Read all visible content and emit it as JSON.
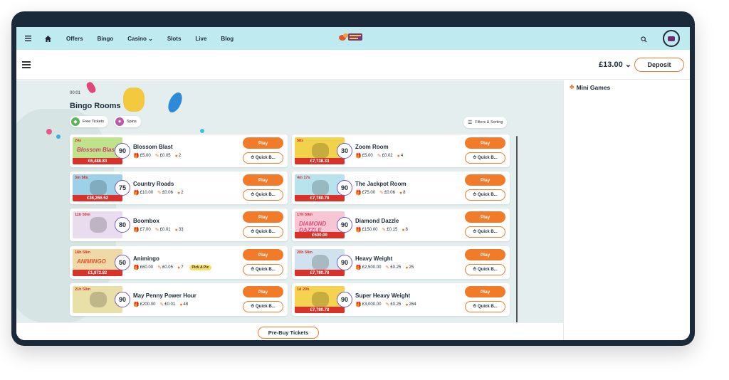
{
  "nav": {
    "links": [
      "Offers",
      "Bingo",
      "Casino",
      "Slots",
      "Live",
      "Blog"
    ],
    "casino_chevron": "⌄",
    "logo_alt": "bingo-logo"
  },
  "account": {
    "balance": "£13.00",
    "chevron": "⌄",
    "deposit_label": "Deposit"
  },
  "bingo": {
    "timer": "00:01",
    "heading": "Bingo Rooms",
    "chips": [
      "Free Tickets",
      "Spins"
    ],
    "filters_label": "Filters & Sorting",
    "rooms": [
      {
        "time": "24s",
        "name": "Blossom Blast",
        "ball": "90",
        "jackpot": "£6,488.83",
        "ticket": "£5.00",
        "price": "£0.05",
        "players": "2",
        "art": "Blossom Blast",
        "art_color": "#d13a6a",
        "bg": "#bfe38a",
        "pick": ""
      },
      {
        "time": "58s",
        "name": "Zoom Room",
        "ball": "30",
        "jackpot": "£7,738.33",
        "ticket": "£5.00",
        "price": "£0.02",
        "players": "4",
        "art": "",
        "art_color": "#222",
        "bg": "#f1d24b",
        "pick": ""
      },
      {
        "time": "3m 58s",
        "name": "Country Roads",
        "ball": "75",
        "jackpot": "£36,266.52",
        "ticket": "£10.00",
        "price": "£0.06",
        "players": "2",
        "art": "",
        "art_color": "#222",
        "bg": "#9ed1e8",
        "pick": ""
      },
      {
        "time": "4m 17s",
        "name": "The Jackpot Room",
        "ball": "90",
        "jackpot": "£7,780.78",
        "ticket": "£75.00",
        "price": "£0.06",
        "players": "8",
        "art": "",
        "art_color": "#222",
        "bg": "#b9e3ec",
        "pick": ""
      },
      {
        "time": "11h 59m",
        "name": "Boombox",
        "ball": "80",
        "jackpot": "",
        "ticket": "£7.00",
        "price": "£0.01",
        "players": "33",
        "art": "",
        "art_color": "#222",
        "bg": "#e9dcef",
        "pick": ""
      },
      {
        "time": "17h 59m",
        "name": "Diamond Dazzle",
        "ball": "90",
        "jackpot": "£500.00",
        "ticket": "£150.00",
        "price": "£0.15",
        "players": "8",
        "art": "DIAMOND DAZZLE",
        "art_color": "#e04b78",
        "bg": "#f7c6d4",
        "pick": ""
      },
      {
        "time": "18h 58m",
        "name": "Animingo",
        "ball": "50",
        "jackpot": "£1,872.82",
        "ticket": "£60.00",
        "price": "£0.05",
        "players": "7",
        "art": "ANIMINGO",
        "art_color": "#e3562f",
        "bg": "#efd9a6",
        "pick": "Pick A Pic"
      },
      {
        "time": "20h 58m",
        "name": "Heavy Weight",
        "ball": "90",
        "jackpot": "£7,780.78",
        "ticket": "£2,500.00",
        "price": "£0.25",
        "players": "25",
        "art": "",
        "art_color": "#222",
        "bg": "#cfe2ee",
        "pick": ""
      },
      {
        "time": "21h 59m",
        "name": "May Penny Power Hour",
        "ball": "90",
        "jackpot": "",
        "ticket": "£200.00",
        "price": "£0.01",
        "players": "48",
        "art": "",
        "art_color": "#222",
        "bg": "#e9e0a8",
        "pick": ""
      },
      {
        "time": "1d 20h",
        "name": "Super Heavy Weight",
        "ball": "90",
        "jackpot": "£7,780.78",
        "ticket": "£3,000.00",
        "price": "£0.25",
        "players": "264",
        "art": "",
        "art_color": "#222",
        "bg": "#f3d34f",
        "pick": ""
      }
    ],
    "play_label": "Play",
    "quick_label": "Quick B...",
    "prebuy_label": "Pre-Buy Tickets"
  },
  "sidebar": {
    "title": "Mini Games"
  },
  "colors": {
    "accent": "#f27b2a",
    "nav_bg": "#bfeaf0",
    "dark": "#1c2b39",
    "jackpot": "#d8322a"
  }
}
